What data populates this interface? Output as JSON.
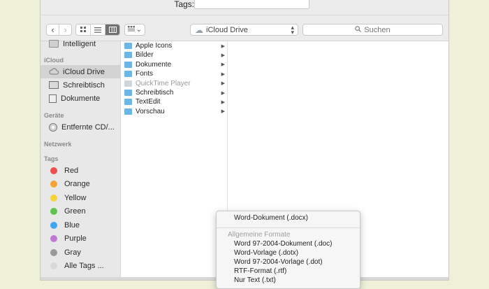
{
  "tags": {
    "label": "Tags:"
  },
  "toolbar": {
    "back_icon": "chevron-left-icon",
    "forward_icon": "chevron-right-icon",
    "view_modes": [
      "icon-view-icon",
      "list-view-icon",
      "column-view-icon"
    ],
    "arrange_icon": "arrange-icon",
    "location": "iCloud Drive",
    "search_placeholder": "Suchen"
  },
  "sidebar": {
    "items_top": [
      {
        "label": "Intelligent",
        "icon": "folder-icon"
      }
    ],
    "icloud_header": "iCloud",
    "icloud_items": [
      {
        "label": "iCloud Drive",
        "icon": "cloud-icon",
        "selected": true
      },
      {
        "label": "Schreibtisch",
        "icon": "desktop-icon"
      },
      {
        "label": "Dokumente",
        "icon": "documents-icon"
      }
    ],
    "devices_header": "Geräte",
    "devices_items": [
      {
        "label": "Entfernte CD/...",
        "icon": "cd-icon"
      }
    ],
    "network_header": "Netzwerk",
    "tags_header": "Tags",
    "tags_items": [
      {
        "label": "Red",
        "color": "#f04f4f"
      },
      {
        "label": "Orange",
        "color": "#f5a433"
      },
      {
        "label": "Yellow",
        "color": "#f5d33b"
      },
      {
        "label": "Green",
        "color": "#5ec44b"
      },
      {
        "label": "Blue",
        "color": "#3ea7ef"
      },
      {
        "label": "Purple",
        "color": "#c07ad6"
      },
      {
        "label": "Gray",
        "color": "#9a9a9a"
      },
      {
        "label": "Alle Tags ...",
        "color": "#d8d8d8"
      }
    ]
  },
  "files": [
    {
      "name": "Apple Icons",
      "dim": false
    },
    {
      "name": "Bilder",
      "dim": false
    },
    {
      "name": "Dokumente",
      "dim": false
    },
    {
      "name": "Fonts",
      "dim": false
    },
    {
      "name": "QuickTime Player",
      "dim": true
    },
    {
      "name": "Schreibtisch",
      "dim": false
    },
    {
      "name": "TextEdit",
      "dim": false
    },
    {
      "name": "Vorschau",
      "dim": false
    }
  ],
  "format_menu": {
    "selected": "Word-Dokument (.docx)",
    "section_header": "Allgemeine Formate",
    "options": [
      "Word 97-2004-Dokument (.doc)",
      "Word-Vorlage (.dotx)",
      "Word 97-2004-Vorlage (.dot)",
      "RTF-Format (.rtf)",
      "Nur Text (.txt)"
    ]
  }
}
